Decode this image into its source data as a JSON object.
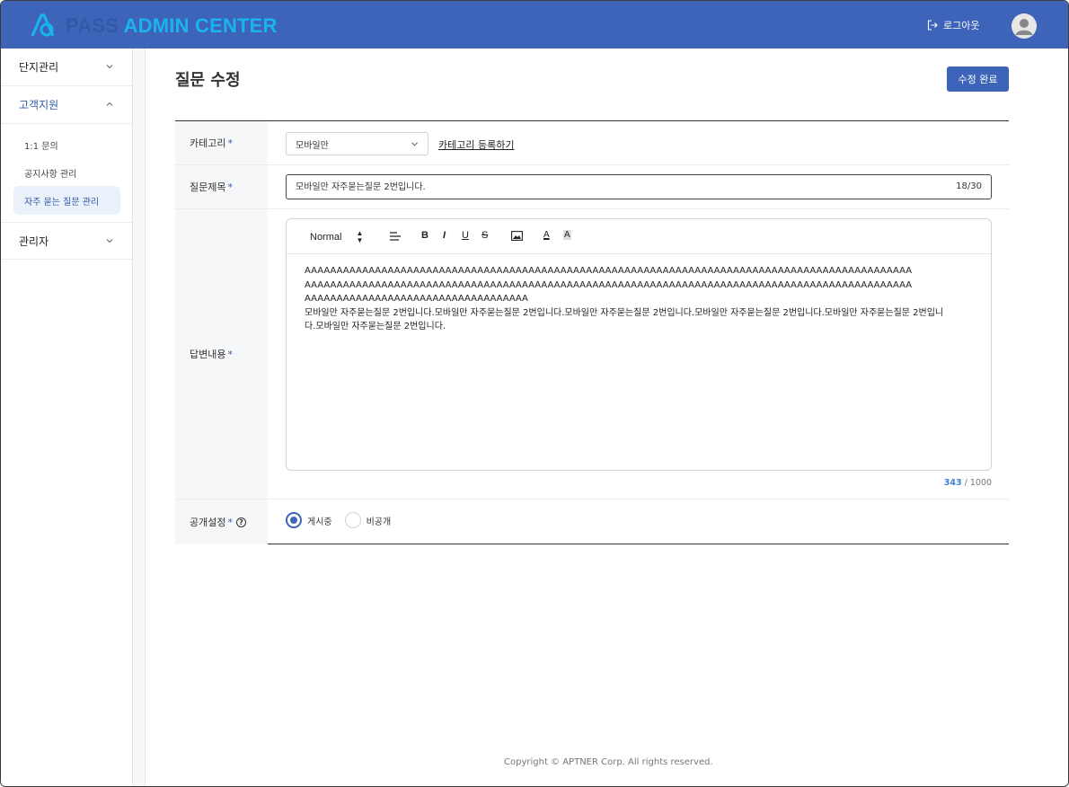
{
  "header": {
    "logo_pass": "PASS",
    "logo_admin": "ADMIN CENTER",
    "logout_label": "로그아웃"
  },
  "sidebar": {
    "groups": [
      {
        "label": "단지관리",
        "expanded": false
      },
      {
        "label": "고객지원",
        "expanded": true
      },
      {
        "label": "관리자",
        "expanded": false
      }
    ],
    "submenu": [
      {
        "label": "1:1 문의",
        "selected": false
      },
      {
        "label": "공지사항 관리",
        "selected": false
      },
      {
        "label": "자주 묻는 질문 관리",
        "selected": true
      }
    ]
  },
  "page": {
    "title": "질문 수정",
    "submit_label": "수정 완료"
  },
  "form": {
    "category": {
      "label": "카테고리",
      "required_mark": "*",
      "selected": "모바일만",
      "link_label": "카테고리 등록하기"
    },
    "question_title": {
      "label": "질문제목",
      "required_mark": "*",
      "value": "모바일만 자주묻는질문 2번입니다.",
      "count": "18/30"
    },
    "answer": {
      "label": "답변내용",
      "required_mark": "*",
      "toolbar": {
        "format": "Normal",
        "align": "≡",
        "bold": "B",
        "italic": "I",
        "underline": "U",
        "strike": "S",
        "color": "A",
        "background": "A"
      },
      "lines": [
        "AAAAAAAAAAAAAAAAAAAAAAAAAAAAAAAAAAAAAAAAAAAAAAAAAAAAAAAAAAAAAAAAAAAAAAAAAAAAAAAAAAAAAAAAAAAAAAA",
        "AAAAAAAAAAAAAAAAAAAAAAAAAAAAAAAAAAAAAAAAAAAAAAAAAAAAAAAAAAAAAAAAAAAAAAAAAAAAAAAAAAAAAAAAAAAAAAA",
        "AAAAAAAAAAAAAAAAAAAAAAAAAAAAAAAAAAA",
        "모바일만 자주묻는질문 2번입니다.모바일만 자주묻는질문 2번입니다.모바일만 자주묻는질문 2번입니다.모바일만 자주묻는질문 2번입니다.모바일만 자주묻는질문 2번입니",
        "다.모바일만 자주묻는질문 2번입니다."
      ],
      "count_current": "343",
      "count_max": " / 1000"
    },
    "visibility": {
      "label": "공개설정",
      "required_mark": "*",
      "options": [
        {
          "label": "게시중",
          "checked": true
        },
        {
          "label": "비공개",
          "checked": false
        }
      ]
    }
  },
  "footer": {
    "copyright": "Copyright © APTNER Corp. All rights reserved."
  }
}
